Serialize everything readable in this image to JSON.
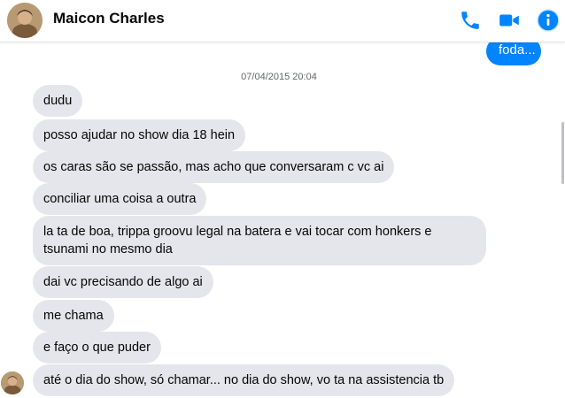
{
  "header": {
    "contact_name": "Maicon Charles",
    "icons": [
      "phone-icon",
      "video-camera-icon",
      "info-icon"
    ],
    "accent_color": "#0084ff"
  },
  "chat": {
    "outgoing_partial": "foda...",
    "timestamp": "07/04/2015 20:04",
    "messages": [
      "dudu",
      "posso ajudar no show dia 18 hein",
      "os caras são se passão, mas acho que conversaram c vc ai",
      "conciliar uma coisa a outra",
      "la ta de boa, trippa groovu legal na batera e vai tocar com honkers e tsunami no mesmo dia",
      "dai vc precisando de algo ai",
      "me chama",
      "e faço o que puder",
      "até o dia do show, só chamar... no dia do show, vo ta na assistencia tb"
    ]
  }
}
